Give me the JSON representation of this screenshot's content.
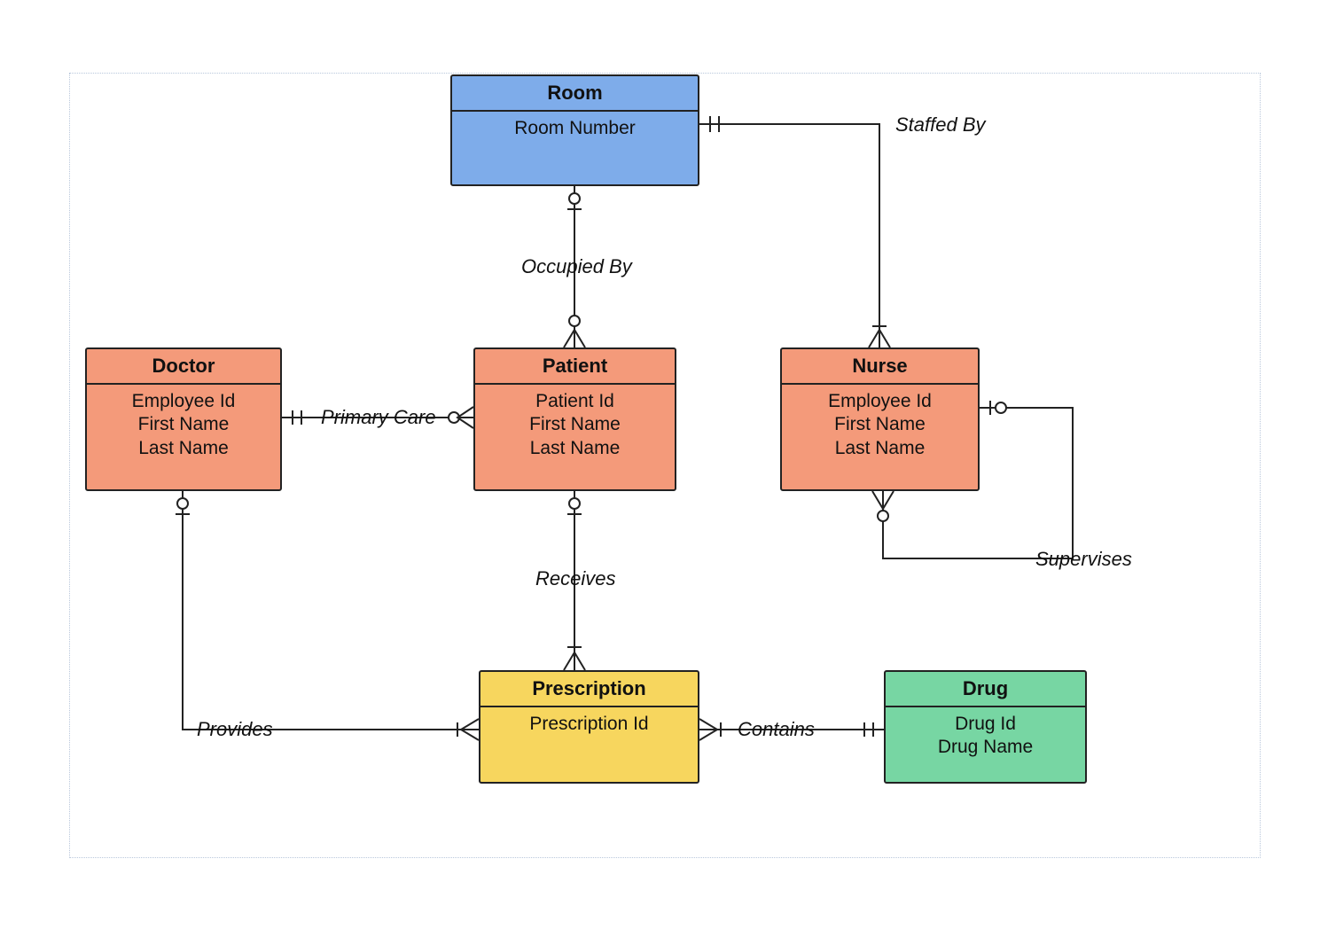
{
  "entities": {
    "room": {
      "title": "Room",
      "attrs": [
        "Room Number"
      ]
    },
    "doctor": {
      "title": "Doctor",
      "attrs": [
        "Employee Id",
        "First Name",
        "Last Name"
      ]
    },
    "patient": {
      "title": "Patient",
      "attrs": [
        "Patient Id",
        "First Name",
        "Last Name"
      ]
    },
    "nurse": {
      "title": "Nurse",
      "attrs": [
        "Employee Id",
        "First Name",
        "Last Name"
      ]
    },
    "prescription": {
      "title": "Prescription",
      "attrs": [
        "Prescription Id"
      ]
    },
    "drug": {
      "title": "Drug",
      "attrs": [
        "Drug Id",
        "Drug Name"
      ]
    }
  },
  "relationships": {
    "occupied_by": "Occupied By",
    "staffed_by": "Staffed By",
    "primary_care": "Primary Care",
    "receives": "Receives",
    "provides": "Provides",
    "contains": "Contains",
    "supervises": "Supervises"
  },
  "colors": {
    "room": "#7eacea",
    "person": "#f49a7a",
    "prescription": "#f7d65e",
    "drug": "#77d6a3"
  }
}
